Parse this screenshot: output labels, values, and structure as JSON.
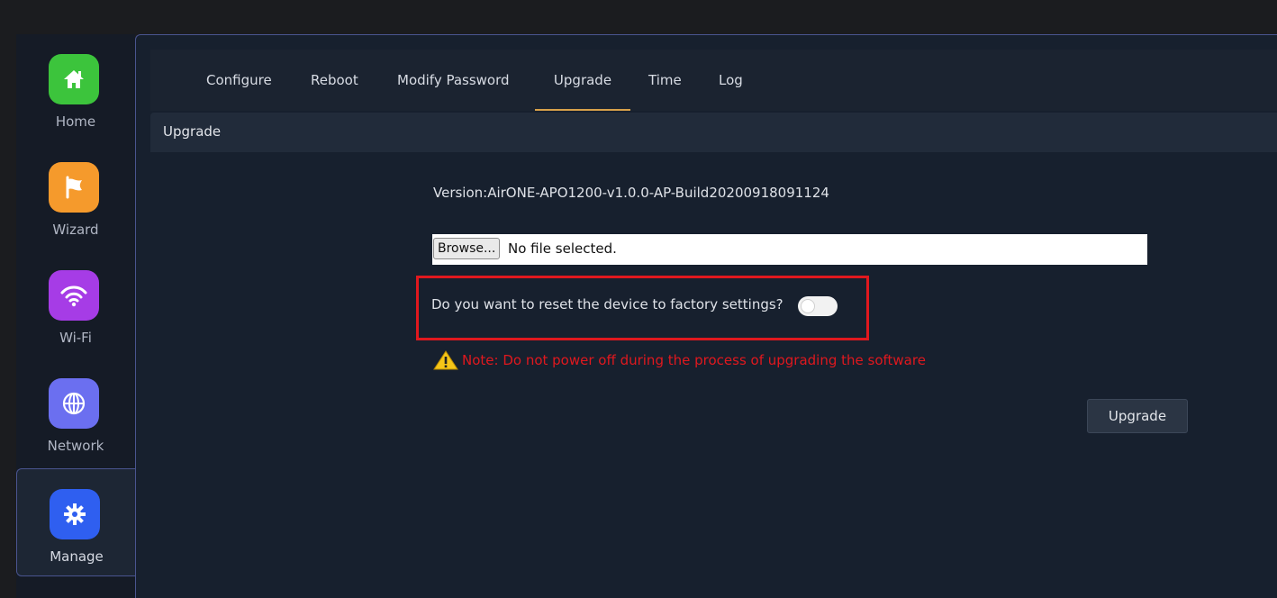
{
  "sidebar": {
    "items": [
      {
        "label": "Home",
        "icon": "home-icon",
        "color": "#3cc43c"
      },
      {
        "label": "Wizard",
        "icon": "flag-icon",
        "color": "#f59a2c"
      },
      {
        "label": "Wi-Fi",
        "icon": "wifi-icon",
        "color": "#a63ce6"
      },
      {
        "label": "Network",
        "icon": "globe-icon",
        "color": "#6b6ff0"
      },
      {
        "label": "Manage",
        "icon": "gear-icon",
        "color": "#2f5ff0",
        "active": true
      }
    ]
  },
  "tabs": [
    {
      "label": "Configure"
    },
    {
      "label": "Reboot"
    },
    {
      "label": "Modify Password"
    },
    {
      "label": "Upgrade",
      "active": true
    },
    {
      "label": "Time"
    },
    {
      "label": "Log"
    }
  ],
  "section": {
    "title": "Upgrade"
  },
  "upgrade": {
    "version": "Version:AirONE-APO1200-v1.0.0-AP-Build20200918091124",
    "browse_label": "Browse...",
    "file_status": "No file selected.",
    "reset_question": "Do you want to reset the device to factory settings?",
    "reset_enabled": false,
    "note": "Note: Do not power off during the process of upgrading the software",
    "submit_label": "Upgrade"
  },
  "colors": {
    "accent_tab": "#d9a14a",
    "warning_text": "#e0181e",
    "highlight_box": "#e0181e"
  }
}
